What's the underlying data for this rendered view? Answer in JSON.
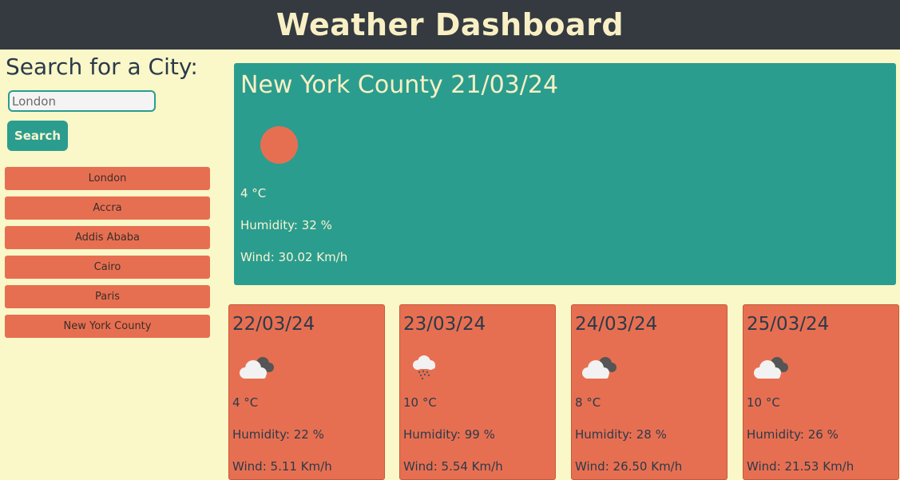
{
  "header": {
    "title": "Weather Dashboard"
  },
  "search": {
    "title": "Search for a City:",
    "placeholder": "London",
    "button_label": "Search"
  },
  "history": [
    {
      "label": "London"
    },
    {
      "label": "Accra"
    },
    {
      "label": "Addis Ababa"
    },
    {
      "label": "Cairo"
    },
    {
      "label": "Paris"
    },
    {
      "label": "New York County"
    }
  ],
  "current": {
    "title": "New York County 21/03/24",
    "icon": "sun-icon",
    "temp": "4 °C",
    "humidity": "Humidity: 32 %",
    "wind": "Wind: 30.02 Km/h"
  },
  "forecast": [
    {
      "date": "22/03/24",
      "icon": "cloudy-icon",
      "temp": "4 °C",
      "humidity": "Humidity: 22 %",
      "wind": "Wind: 5.11 Km/h"
    },
    {
      "date": "23/03/24",
      "icon": "rain-icon",
      "temp": "10 °C",
      "humidity": "Humidity: 99 %",
      "wind": "Wind: 5.54 Km/h"
    },
    {
      "date": "24/03/24",
      "icon": "cloudy-icon",
      "temp": "8 °C",
      "humidity": "Humidity: 28 %",
      "wind": "Wind: 26.50 Km/h"
    },
    {
      "date": "25/03/24",
      "icon": "cloudy-icon",
      "temp": "10 °C",
      "humidity": "Humidity: 26 %",
      "wind": "Wind: 21.53 Km/h"
    }
  ],
  "colors": {
    "header_bg": "#343a40",
    "page_bg": "#faf7c8",
    "accent_teal": "#2a9d8f",
    "accent_orange": "#e76f51",
    "title_cream": "#f8f0c4"
  }
}
